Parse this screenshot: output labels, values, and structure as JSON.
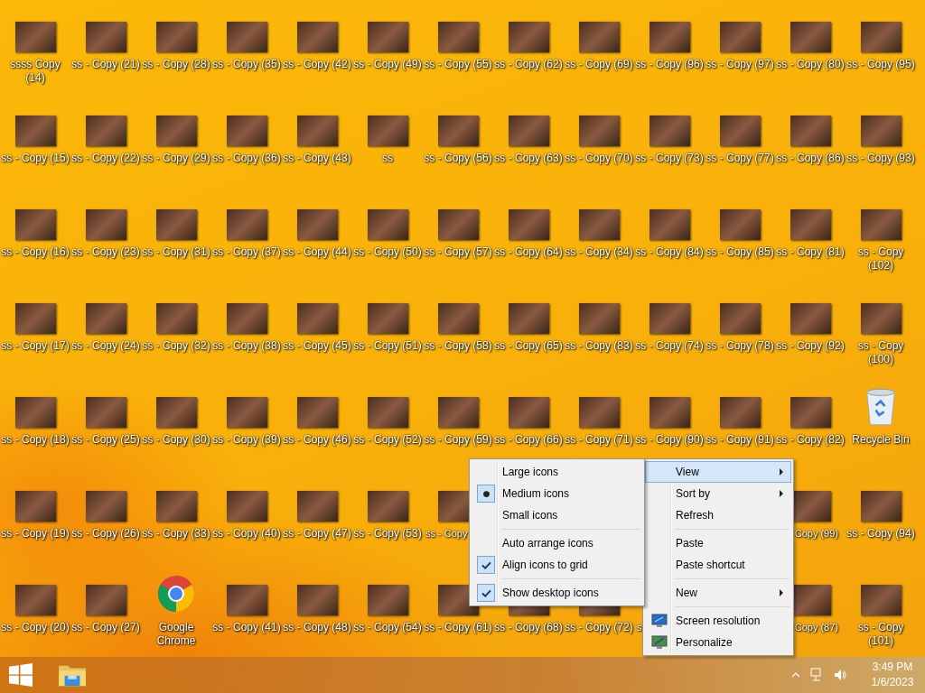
{
  "desktop": {
    "rows": [
      [
        {
          "kind": "photo",
          "label": "ssss Copy (14)"
        },
        {
          "kind": "photo",
          "label": "ss - Copy (21)"
        },
        {
          "kind": "photo",
          "label": "ss - Copy (28)"
        },
        {
          "kind": "photo",
          "label": "ss - Copy (35)"
        },
        {
          "kind": "photo",
          "label": "ss - Copy (42)"
        },
        {
          "kind": "photo",
          "label": "ss - Copy (49)"
        },
        {
          "kind": "photo",
          "label": "ss - Copy (55)"
        },
        {
          "kind": "photo",
          "label": "ss - Copy (62)"
        },
        {
          "kind": "photo",
          "label": "ss - Copy (69)"
        },
        {
          "kind": "photo",
          "label": "ss - Copy (96)"
        },
        {
          "kind": "photo",
          "label": "ss - Copy (97)"
        },
        {
          "kind": "photo",
          "label": "ss - Copy (80)"
        },
        {
          "kind": "photo",
          "label": "ss - Copy (95)"
        }
      ],
      [
        {
          "kind": "photo",
          "label": "ss - Copy (15)"
        },
        {
          "kind": "photo",
          "label": "ss - Copy (22)"
        },
        {
          "kind": "photo",
          "label": "ss - Copy (29)"
        },
        {
          "kind": "photo",
          "label": "ss - Copy (36)"
        },
        {
          "kind": "photo",
          "label": "ss - Copy (43)"
        },
        {
          "kind": "photo",
          "label": "ss"
        },
        {
          "kind": "photo",
          "label": "ss - Copy (56)"
        },
        {
          "kind": "photo",
          "label": "ss - Copy (63)"
        },
        {
          "kind": "photo",
          "label": "ss - Copy (70)"
        },
        {
          "kind": "photo",
          "label": "ss - Copy (73)"
        },
        {
          "kind": "photo",
          "label": "ss - Copy (77)"
        },
        {
          "kind": "photo",
          "label": "ss - Copy (86)"
        },
        {
          "kind": "photo",
          "label": "ss - Copy (93)"
        }
      ],
      [
        {
          "kind": "photo",
          "label": "ss - Copy (16)"
        },
        {
          "kind": "photo",
          "label": "ss - Copy (23)"
        },
        {
          "kind": "photo",
          "label": "ss - Copy (31)"
        },
        {
          "kind": "photo",
          "label": "ss - Copy (37)"
        },
        {
          "kind": "photo",
          "label": "ss - Copy (44)"
        },
        {
          "kind": "photo",
          "label": "ss - Copy (50)"
        },
        {
          "kind": "photo",
          "label": "ss - Copy (57)"
        },
        {
          "kind": "photo",
          "label": "ss - Copy (64)"
        },
        {
          "kind": "photo",
          "label": "ss - Copy (34)"
        },
        {
          "kind": "photo",
          "label": "ss - Copy (84)"
        },
        {
          "kind": "photo",
          "label": "ss - Copy (85)"
        },
        {
          "kind": "photo",
          "label": "ss - Copy (81)"
        },
        {
          "kind": "photo",
          "label": "ss - Copy (102)"
        }
      ],
      [
        {
          "kind": "photo",
          "label": "ss - Copy (17)"
        },
        {
          "kind": "photo",
          "label": "ss - Copy (24)"
        },
        {
          "kind": "photo",
          "label": "ss - Copy (32)"
        },
        {
          "kind": "photo",
          "label": "ss - Copy (38)"
        },
        {
          "kind": "photo",
          "label": "ss - Copy (45)"
        },
        {
          "kind": "photo",
          "label": "ss - Copy (51)"
        },
        {
          "kind": "photo",
          "label": "ss - Copy (58)"
        },
        {
          "kind": "photo",
          "label": "ss - Copy (65)"
        },
        {
          "kind": "photo",
          "label": "ss - Copy (83)"
        },
        {
          "kind": "photo",
          "label": "ss - Copy (74)"
        },
        {
          "kind": "photo",
          "label": "ss - Copy (78)"
        },
        {
          "kind": "photo",
          "label": "ss - Copy (92)"
        },
        {
          "kind": "photo",
          "label": "ss - Copy (100)"
        }
      ],
      [
        {
          "kind": "photo",
          "label": "ss - Copy (18)"
        },
        {
          "kind": "photo",
          "label": "ss - Copy (25)"
        },
        {
          "kind": "photo",
          "label": "ss - Copy (30)"
        },
        {
          "kind": "photo",
          "label": "ss - Copy (39)"
        },
        {
          "kind": "photo",
          "label": "ss - Copy (46)"
        },
        {
          "kind": "photo",
          "label": "ss - Copy (52)"
        },
        {
          "kind": "photo",
          "label": "ss - Copy (59)"
        },
        {
          "kind": "photo",
          "label": "ss - Copy (66)"
        },
        {
          "kind": "photo",
          "label": "ss - Copy (71)"
        },
        {
          "kind": "photo",
          "label": "ss - Copy (90)"
        },
        {
          "kind": "photo",
          "label": "ss - Copy (91)"
        },
        {
          "kind": "photo",
          "label": "ss - Copy (82)"
        },
        {
          "kind": "recycle",
          "label": "Recycle Bin"
        }
      ],
      [
        {
          "kind": "photo",
          "label": "ss - Copy (19)"
        },
        {
          "kind": "photo",
          "label": "ss - Copy (26)"
        },
        {
          "kind": "photo",
          "label": "ss - Copy (33)"
        },
        {
          "kind": "photo",
          "label": "ss - Copy (40)"
        },
        {
          "kind": "photo",
          "label": "ss - Copy (47)"
        },
        {
          "kind": "photo",
          "label": "ss - Copy (53)"
        },
        {
          "kind": "photo-left",
          "label": "ss - Copy"
        },
        {
          "kind": "none"
        },
        {
          "kind": "none"
        },
        {
          "kind": "none"
        },
        {
          "kind": "none"
        },
        {
          "kind": "photo-right",
          "label": "Copy (99)"
        },
        {
          "kind": "photo",
          "label": "ss - Copy (94)"
        }
      ],
      [
        {
          "kind": "photo",
          "label": "ss - Copy (20)"
        },
        {
          "kind": "photo",
          "label": "ss - Copy (27)"
        },
        {
          "kind": "chrome",
          "label": "Google Chrome"
        },
        {
          "kind": "photo",
          "label": "ss - Copy (41)"
        },
        {
          "kind": "photo",
          "label": "ss - Copy (48)"
        },
        {
          "kind": "photo",
          "label": "ss - Copy (54)"
        },
        {
          "kind": "photo",
          "label": "ss - Copy (61)"
        },
        {
          "kind": "photo",
          "label": "ss - Copy (68)"
        },
        {
          "kind": "photo",
          "label": "ss - Copy (72)"
        },
        {
          "kind": "fragment",
          "label": "s"
        },
        {
          "kind": "none"
        },
        {
          "kind": "photo-right",
          "label": "Copy (87)"
        },
        {
          "kind": "photo",
          "label": "ss - Copy (101)"
        }
      ]
    ]
  },
  "context_menu": {
    "groups": [
      [
        {
          "label": "View",
          "submenu": true,
          "selected": true
        },
        {
          "label": "Sort by",
          "submenu": true,
          "selected": false
        },
        {
          "label": "Refresh",
          "submenu": false,
          "selected": false
        }
      ],
      [
        {
          "label": "Paste",
          "submenu": false,
          "selected": false
        },
        {
          "label": "Paste shortcut",
          "submenu": false,
          "selected": false
        }
      ],
      [
        {
          "label": "New",
          "submenu": true,
          "selected": false
        }
      ],
      [
        {
          "label": "Screen resolution",
          "submenu": false,
          "selected": false
        },
        {
          "label": "Personalize",
          "submenu": false,
          "selected": false
        }
      ]
    ]
  },
  "view_menu": {
    "groups": [
      [
        {
          "label": "Large icons",
          "kind": "radio",
          "selected": false
        },
        {
          "label": "Medium icons",
          "kind": "radio",
          "selected": true
        },
        {
          "label": "Small icons",
          "kind": "radio",
          "selected": false
        }
      ],
      [
        {
          "label": "Auto arrange icons",
          "kind": "check",
          "selected": false
        },
        {
          "label": "Align icons to grid",
          "kind": "check",
          "selected": true
        }
      ],
      [
        {
          "label": "Show desktop icons",
          "kind": "check",
          "selected": true
        }
      ]
    ]
  },
  "taskbar": {
    "time": "3:49 PM",
    "date": "1/6/2023"
  }
}
